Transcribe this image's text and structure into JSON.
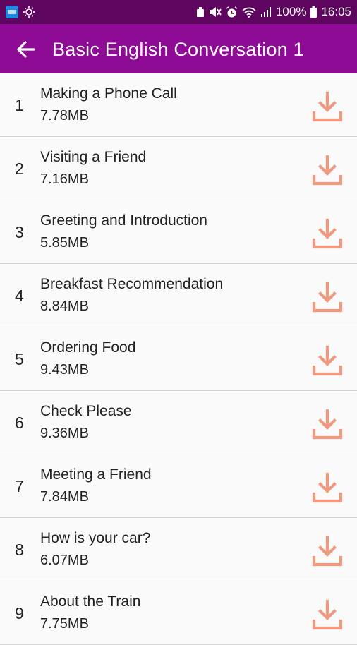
{
  "status_bar": {
    "battery": "100%",
    "time": "16:05"
  },
  "app_bar": {
    "title": "Basic English Conversation 1"
  },
  "colors": {
    "status_bar_bg": "#5e0560",
    "app_bar_bg": "#8e0b95",
    "download_icon": "#ef9a7f",
    "divider": "#d6d6d6"
  },
  "icons": {
    "back": "arrow-left-icon",
    "download": "download-icon"
  },
  "lessons": [
    {
      "number": "1",
      "title": "Making a Phone Call",
      "size": "7.78MB"
    },
    {
      "number": "2",
      "title": "Visiting a Friend",
      "size": "7.16MB"
    },
    {
      "number": "3",
      "title": "Greeting and Introduction",
      "size": "5.85MB"
    },
    {
      "number": "4",
      "title": "Breakfast Recommendation",
      "size": "8.84MB"
    },
    {
      "number": "5",
      "title": "Ordering Food",
      "size": "9.43MB"
    },
    {
      "number": "6",
      "title": "Check Please",
      "size": "9.36MB"
    },
    {
      "number": "7",
      "title": "Meeting a Friend",
      "size": "7.84MB"
    },
    {
      "number": "8",
      "title": "How is your car?",
      "size": "6.07MB"
    },
    {
      "number": "9",
      "title": "About the Train",
      "size": "7.75MB"
    }
  ]
}
